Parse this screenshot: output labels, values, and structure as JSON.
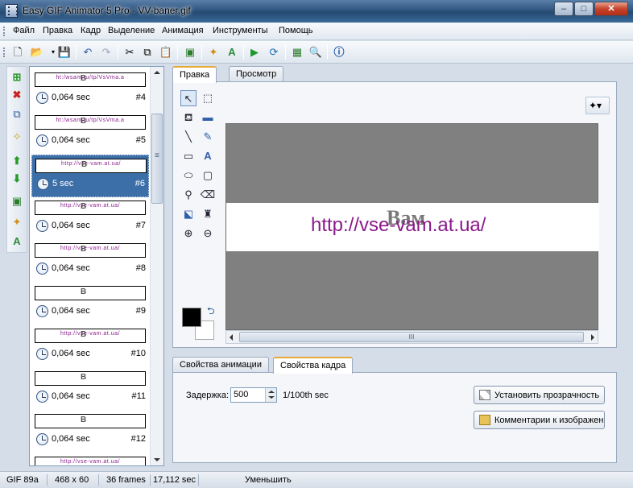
{
  "window": {
    "title": "Easy GIF Animator 5 Pro - VV-baner.gif",
    "minimize": "‒",
    "maximize": "□",
    "close": "✕"
  },
  "menu": [
    "Файл",
    "Правка",
    "Кадр",
    "Выделение",
    "Анимация",
    "Инструменты",
    "Помощь"
  ],
  "toolbar": {
    "icons": [
      "new-file-icon",
      "open-folder-icon",
      "save-icon",
      "undo-icon",
      "redo-icon",
      "cut-icon",
      "copy-icon",
      "paste-icon",
      "resize-image-icon",
      "magic-wand-icon",
      "text-effect-icon",
      "play-icon",
      "export-icon",
      "insert-image-icon",
      "preview-zoom-icon",
      "help-icon"
    ]
  },
  "frames": [
    {
      "time": "0,064 sec",
      "number": "#4",
      "thumb_text": "ht:/wsam.tu/tp/VsVma.a",
      "selected": false
    },
    {
      "time": "0,064 sec",
      "number": "#5",
      "thumb_text": "ht:/wsam.tu/tp/VsVma.a",
      "selected": false
    },
    {
      "time": "5 sec",
      "number": "#6",
      "thumb_text": "http://vse-vam.at.ua/",
      "selected": true
    },
    {
      "time": "0,064 sec",
      "number": "#7",
      "thumb_text": "http://vse-vam.at.ua/",
      "selected": false
    },
    {
      "time": "0,064 sec",
      "number": "#8",
      "thumb_text": "http://vse-vam.at.ua/",
      "selected": false
    },
    {
      "time": "0,064 sec",
      "number": "#9",
      "thumb_text": "",
      "selected": false
    },
    {
      "time": "0,064 sec",
      "number": "#10",
      "thumb_text": "http://vse-vam.at.ua/",
      "selected": false
    },
    {
      "time": "0,064 sec",
      "number": "#11",
      "thumb_text": "",
      "selected": false
    },
    {
      "time": "0,064 sec",
      "number": "#12",
      "thumb_text": "",
      "selected": false
    },
    {
      "time": "",
      "number": "",
      "thumb_text": "http://vse-vam.at.ua/",
      "selected": false
    }
  ],
  "editor": {
    "tabs": [
      "Правка",
      "Просмотр"
    ],
    "active_tab": "Правка",
    "banner_url": "http://vse-vam.at.ua/",
    "banner_logo": "Bам",
    "scroll_grip": "III"
  },
  "properties": {
    "tabs": [
      "Свойства анимации",
      "Свойства кадра"
    ],
    "active_tab": "Свойства кадра",
    "delay_label": "Задержка:",
    "delay_value": "500",
    "delay_unit": "1/100th sec",
    "btn_transparency": "Установить прозрачность",
    "btn_comments": "Комментарии к изображению"
  },
  "status": {
    "format": "GIF 89a",
    "size": "468 x 60",
    "frames": "36 frames",
    "duration": "17,112 sec",
    "action": "Уменьшить"
  }
}
